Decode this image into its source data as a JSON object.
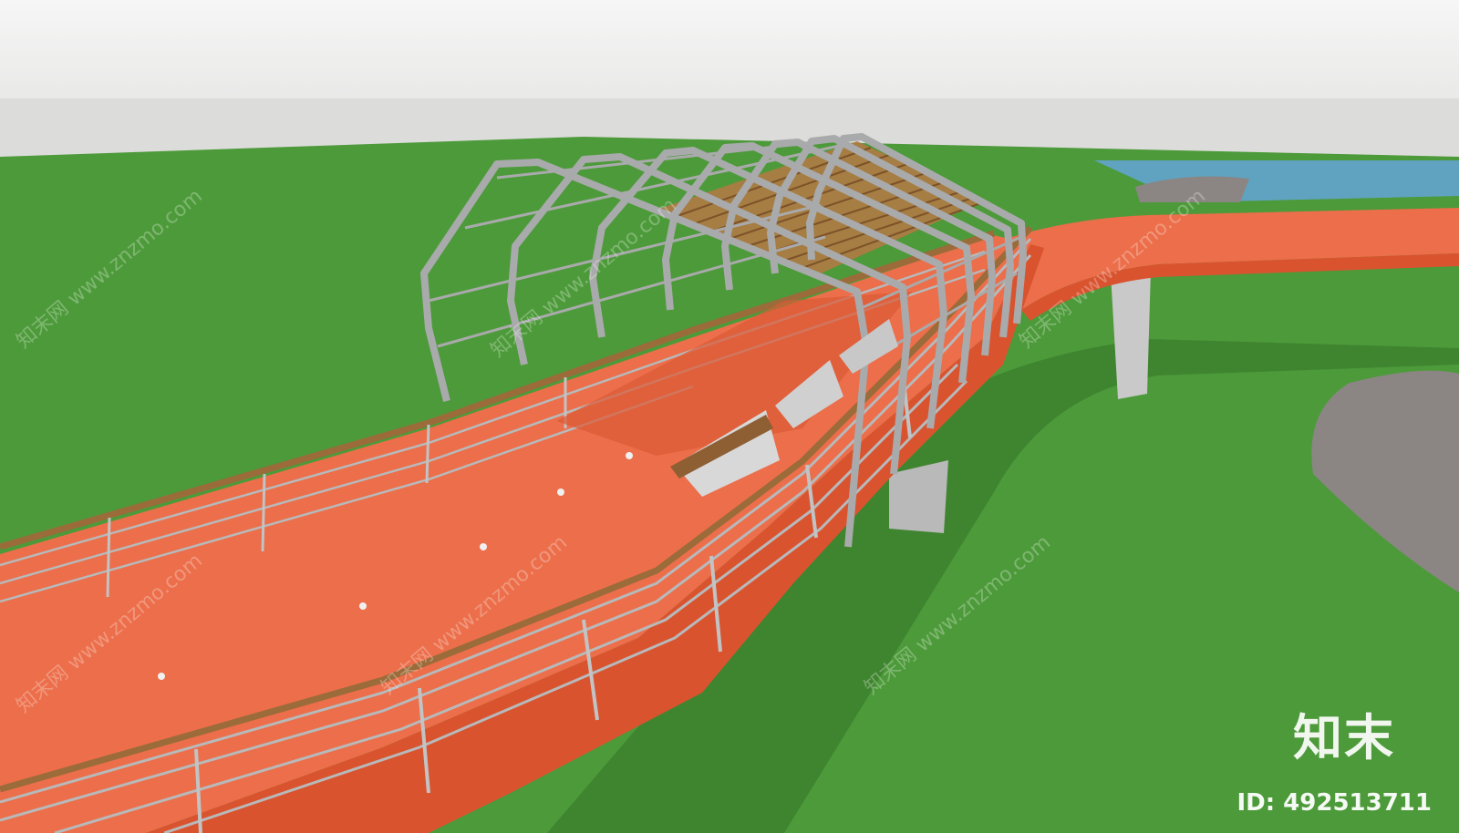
{
  "scene": {
    "subject": "elevated orange pedestrian bridge with steel arch canopy over grass",
    "colors": {
      "sky": "#f1f1f1",
      "horizon": "#dcdcda",
      "grass": "#4d9a3a",
      "grass_dark": "#3f8530",
      "deck": "#ec6e4a",
      "deck_edge": "#d9532f",
      "steel": "#a9aaab",
      "wood_rail": "#9b6b3a",
      "water": "#5fa3c0",
      "rock": "#8b8684"
    }
  },
  "watermark": {
    "logo_text": "知末",
    "id_text": "ID: 492513711",
    "diagonal_text": "知末网 www.znzmo.com"
  }
}
